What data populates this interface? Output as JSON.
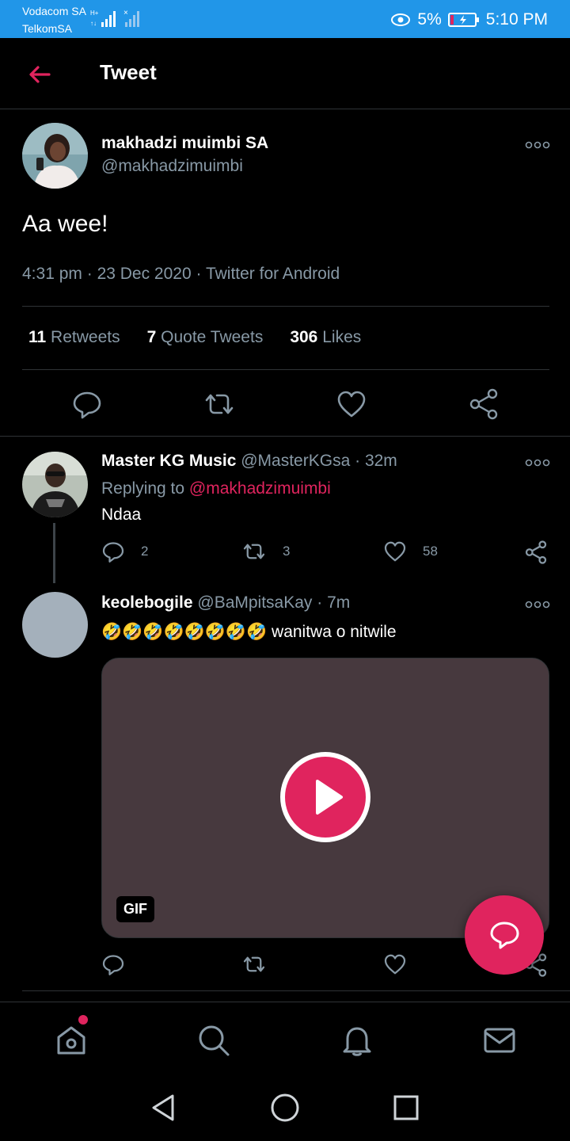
{
  "status_bar": {
    "carrier_1": "Vodacom SA",
    "carrier_2": "TelkomSA",
    "battery": "5%",
    "time": "5:10 PM",
    "bg_color": "#2196e8"
  },
  "header": {
    "title": "Tweet",
    "back_icon": "arrow-left-icon"
  },
  "main_tweet": {
    "display_name": "makhadzi muimbi SA",
    "handle": "@makhadzimuimbi",
    "text": "Aa wee!",
    "time": "4:31 pm",
    "date": "23 Dec 2020",
    "source": "Twitter for Android",
    "stats": {
      "retweets_count": "11",
      "retweets_label": "Retweets",
      "quotes_count": "7",
      "quotes_label": "Quote Tweets",
      "likes_count": "306",
      "likes_label": "Likes"
    }
  },
  "replies": [
    {
      "display_name": "Master KG Music",
      "handle": "@MasterKGsa",
      "sep": "·",
      "age": "32m",
      "replying_prefix": "Replying to",
      "replying_to": "@makhadzimuimbi",
      "text": "Ndaa",
      "reply_count": "2",
      "retweet_count": "3",
      "like_count": "58"
    },
    {
      "display_name": "keolebogile",
      "handle": "@BaMpitsaKay",
      "sep": "·",
      "age": "7m",
      "emoji": "🤣🤣🤣🤣🤣🤣🤣🤣",
      "text": "wanitwa o nitwile",
      "media_badge": "GIF"
    }
  ],
  "accent_color": "#e0245e",
  "bottom_nav": [
    "home-icon",
    "search-icon",
    "bell-icon",
    "mail-icon"
  ],
  "system_nav": [
    "back-triangle-icon",
    "home-circle-icon",
    "recents-square-icon"
  ]
}
